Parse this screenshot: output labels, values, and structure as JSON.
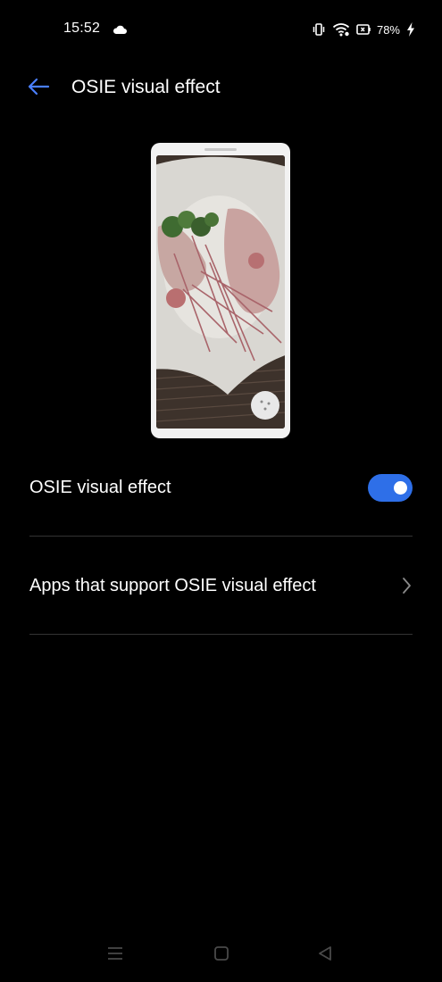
{
  "status_bar": {
    "time": "15:52",
    "battery": "78%",
    "icons": [
      "cloud-icon",
      "vibrate-icon",
      "wifi-icon",
      "battery-saver-icon",
      "charging-icon"
    ]
  },
  "header": {
    "title": "OSIE visual effect",
    "back_icon": "arrow-left-icon"
  },
  "preview": {
    "description_icon": "phone-preview-image"
  },
  "settings": {
    "osie_toggle": {
      "label": "OSIE visual effect",
      "enabled": true
    },
    "apps_row": {
      "label": "Apps that support OSIE visual effect",
      "icon": "chevron-right-icon"
    }
  },
  "nav_bar": {
    "icons": [
      "menu-icon",
      "home-icon",
      "back-triangle-icon"
    ]
  },
  "colors": {
    "background": "#000000",
    "accent": "#2e6fe8",
    "back_arrow": "#4a7fff",
    "divider": "#333333"
  }
}
